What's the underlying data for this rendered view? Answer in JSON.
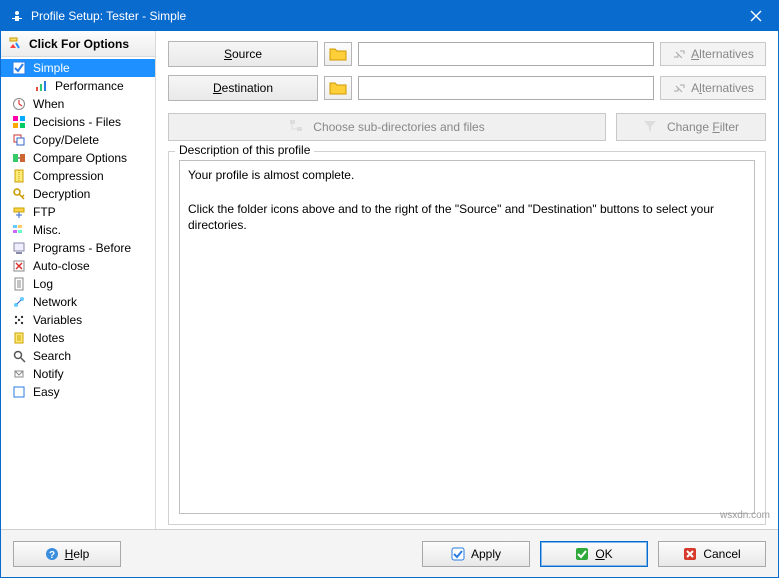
{
  "window": {
    "title": "Profile Setup: Tester - Simple"
  },
  "sidebar": {
    "click_for_options": "Click For Options",
    "items": [
      {
        "label": "Simple",
        "selected": true,
        "child": false,
        "icon": "check"
      },
      {
        "label": "Performance",
        "selected": false,
        "child": true,
        "icon": "bars"
      },
      {
        "label": "When",
        "selected": false,
        "child": false,
        "icon": "clock"
      },
      {
        "label": "Decisions - Files",
        "selected": false,
        "child": false,
        "icon": "grid"
      },
      {
        "label": "Copy/Delete",
        "selected": false,
        "child": false,
        "icon": "copy"
      },
      {
        "label": "Compare Options",
        "selected": false,
        "child": false,
        "icon": "compare"
      },
      {
        "label": "Compression",
        "selected": false,
        "child": false,
        "icon": "compress"
      },
      {
        "label": "Decryption",
        "selected": false,
        "child": false,
        "icon": "key"
      },
      {
        "label": "FTP",
        "selected": false,
        "child": false,
        "icon": "ftp"
      },
      {
        "label": "Misc.",
        "selected": false,
        "child": false,
        "icon": "misc"
      },
      {
        "label": "Programs - Before",
        "selected": false,
        "child": false,
        "icon": "programs"
      },
      {
        "label": "Auto-close",
        "selected": false,
        "child": false,
        "icon": "autoclose"
      },
      {
        "label": "Log",
        "selected": false,
        "child": false,
        "icon": "log"
      },
      {
        "label": "Network",
        "selected": false,
        "child": false,
        "icon": "network"
      },
      {
        "label": "Variables",
        "selected": false,
        "child": false,
        "icon": "variables"
      },
      {
        "label": "Notes",
        "selected": false,
        "child": false,
        "icon": "notes"
      },
      {
        "label": "Search",
        "selected": false,
        "child": false,
        "icon": "search"
      },
      {
        "label": "Notify",
        "selected": false,
        "child": false,
        "icon": "notify"
      },
      {
        "label": "Easy",
        "selected": false,
        "child": false,
        "icon": "easy"
      }
    ]
  },
  "main": {
    "source_label": "Source",
    "destination_label": "Destination",
    "source_path": "",
    "destination_path": "",
    "alternatives_label": "Alternatives",
    "choose_subdirs_label": "Choose sub-directories and files",
    "change_filter_label": "Change Filter",
    "description_legend": "Description of this profile",
    "description_line1": "Your profile is almost complete.",
    "description_line2": "Click the folder icons above and to the right of the \"Source\" and \"Destination\" buttons to select your directories."
  },
  "footer": {
    "help_label": "Help",
    "apply_label": "Apply",
    "ok_label": "OK",
    "cancel_label": "Cancel"
  },
  "watermark": "wsxdn.com"
}
